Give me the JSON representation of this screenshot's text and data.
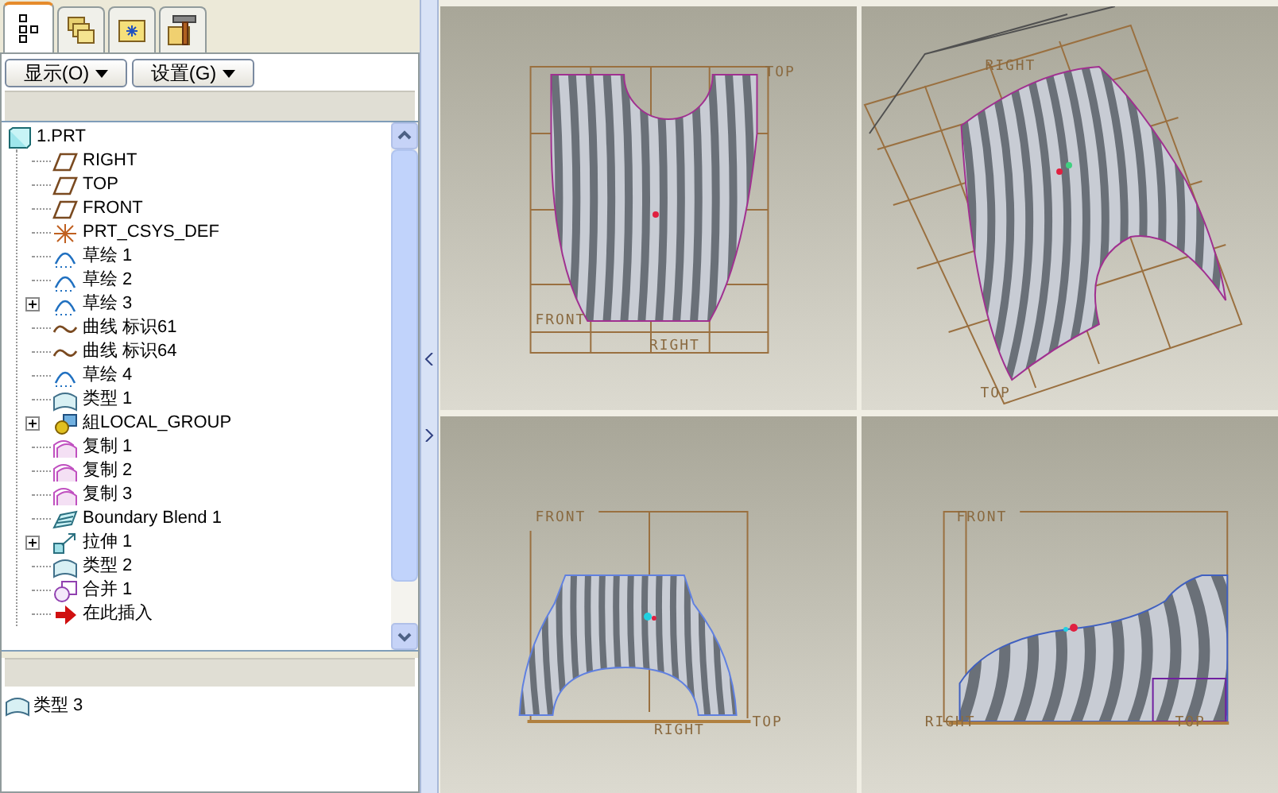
{
  "tabs": [
    {
      "kind": "tree",
      "selected": true
    },
    {
      "kind": "layers",
      "selected": false
    },
    {
      "kind": "folder",
      "selected": false
    },
    {
      "kind": "tools",
      "selected": false
    }
  ],
  "toolbar": [
    {
      "label": "显示(O)"
    },
    {
      "label": "设置(G)"
    }
  ],
  "tree": {
    "label": "1.PRT",
    "kind": "part",
    "children": [
      {
        "label": "RIGHT",
        "kind": "plane",
        "expandable": false
      },
      {
        "label": "TOP",
        "kind": "plane",
        "expandable": false
      },
      {
        "label": "FRONT",
        "kind": "plane",
        "expandable": false
      },
      {
        "label": "PRT_CSYS_DEF",
        "kind": "csys",
        "expandable": false
      },
      {
        "label": "草绘 1",
        "kind": "sketch",
        "expandable": false
      },
      {
        "label": "草绘 2",
        "kind": "sketch",
        "expandable": false
      },
      {
        "label": "草绘 3",
        "kind": "sketch",
        "expandable": true
      },
      {
        "label": "曲线 标识61",
        "kind": "curve",
        "expandable": false
      },
      {
        "label": "曲线 标识64",
        "kind": "curve",
        "expandable": false
      },
      {
        "label": "草绘 4",
        "kind": "sketch",
        "expandable": false
      },
      {
        "label": "类型 1",
        "kind": "surface",
        "expandable": false
      },
      {
        "label": "組LOCAL_GROUP",
        "kind": "group",
        "expandable": true
      },
      {
        "label": "复制 1",
        "kind": "copy",
        "expandable": false
      },
      {
        "label": "复制 2",
        "kind": "copy",
        "expandable": false
      },
      {
        "label": "复制 3",
        "kind": "copy",
        "expandable": false
      },
      {
        "label": "Boundary Blend 1",
        "kind": "blend",
        "expandable": false
      },
      {
        "label": "拉伸 1",
        "kind": "extrude",
        "expandable": true
      },
      {
        "label": "类型 2",
        "kind": "surface",
        "expandable": false
      },
      {
        "label": "合并 1",
        "kind": "merge",
        "expandable": false
      },
      {
        "label": "在此插入",
        "kind": "insert",
        "expandable": false
      }
    ]
  },
  "detail_list": [
    {
      "label": "类型 3",
      "kind": "surface"
    }
  ],
  "viewports": [
    {
      "kind": "front",
      "labels": [
        "TOP",
        "FRONT",
        "RIGHT"
      ]
    },
    {
      "kind": "iso",
      "labels": [
        "RIGHT",
        "TOP"
      ]
    },
    {
      "kind": "top",
      "labels": [
        "FRONT",
        "RIGHT",
        "TOP"
      ]
    },
    {
      "kind": "side",
      "labels": [
        "FRONT",
        "RIGHT",
        "TOP"
      ]
    }
  ]
}
